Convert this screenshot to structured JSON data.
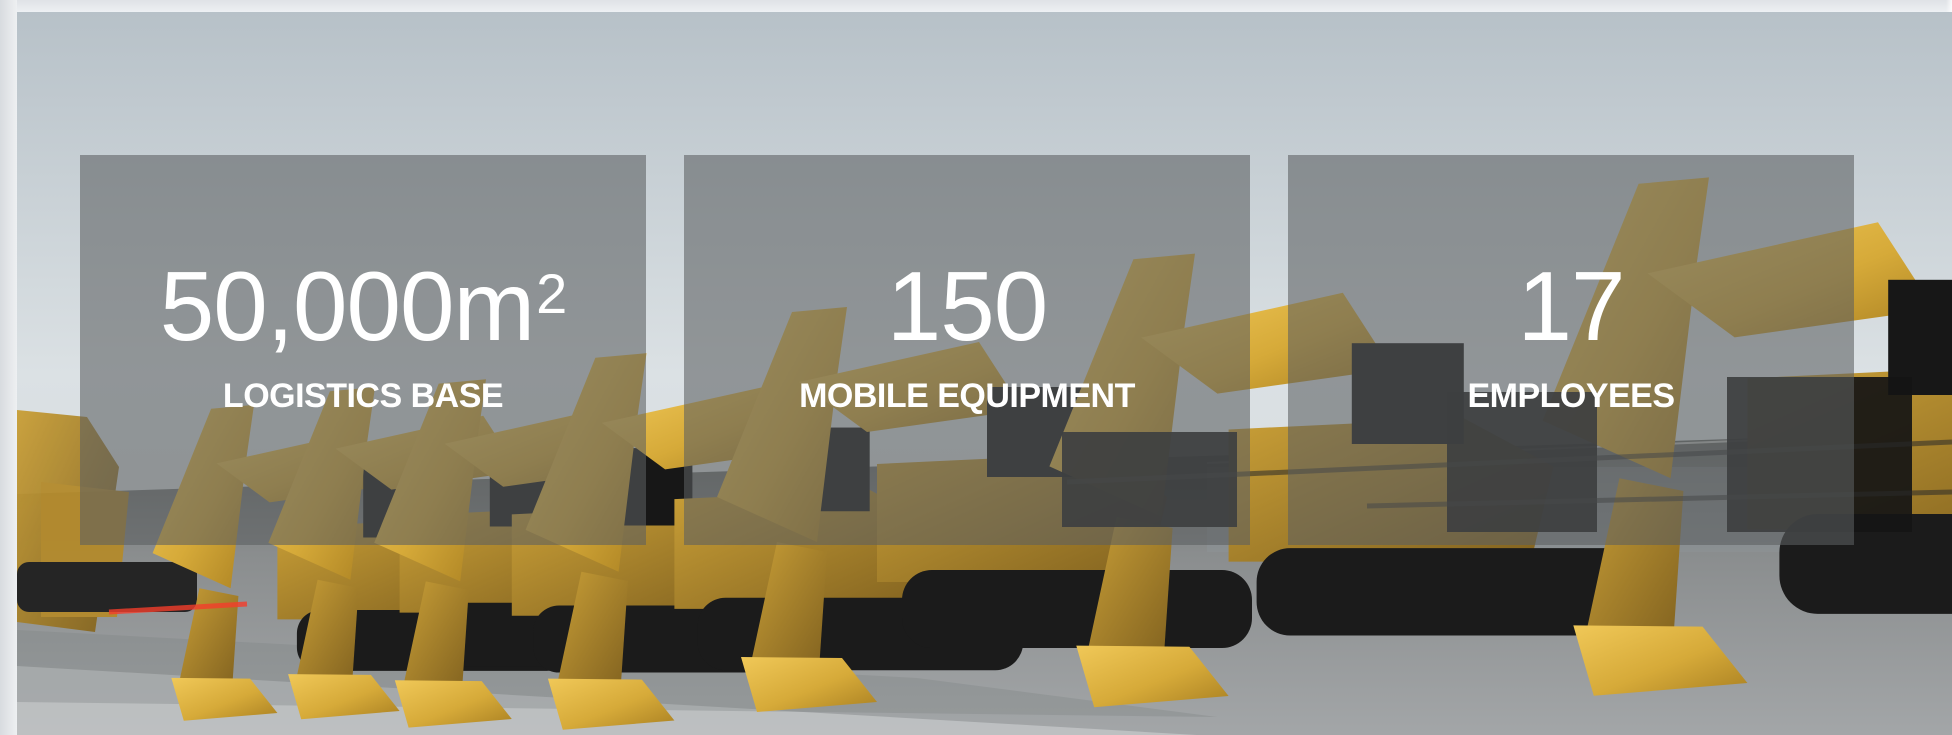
{
  "hero": {
    "image_label": "Row of yellow CAT excavators in a logistics yard"
  },
  "stats": [
    {
      "number": "50,000m",
      "superscript": "2",
      "label": "LOGISTICS BASE"
    },
    {
      "number": "150",
      "superscript": "",
      "label": "MOBILE EQUIPMENT"
    },
    {
      "number": "17",
      "superscript": "",
      "label": "EMPLOYEES"
    }
  ],
  "colors": {
    "machine_yellow": "#d7ad3d",
    "panel_overlay": "#5c5f61",
    "text": "#ffffff"
  }
}
